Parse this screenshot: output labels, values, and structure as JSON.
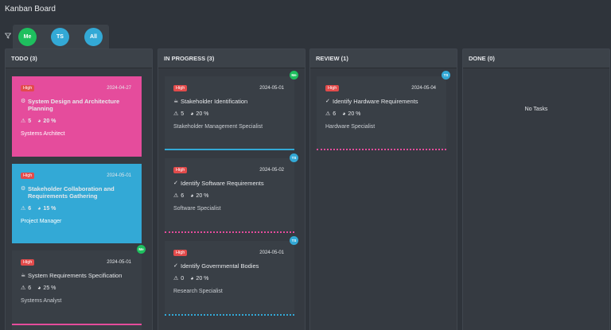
{
  "board": {
    "title": "Kanban Board"
  },
  "filters": [
    {
      "label": "Me",
      "color": "#1ebf5e"
    },
    {
      "label": "TS",
      "color": "#33a9d6"
    },
    {
      "label": "All",
      "color": "#33a9d6"
    }
  ],
  "columns": [
    {
      "title": "TODO (3)"
    },
    {
      "title": "IN PROGRESS (3)"
    },
    {
      "title": "REVIEW (1)"
    },
    {
      "title": "DONE (0)",
      "empty_text": "No Tasks"
    }
  ],
  "cards": [
    {
      "priority": "High",
      "date": "2024-04-27",
      "icon": "⚙",
      "title": "System Design and Architecture Planning",
      "warnings": "5",
      "progress": "20 %",
      "role": "Systems Architect"
    },
    {
      "priority": "High",
      "date": "2024-05-01",
      "icon": "⚙",
      "title": "Stakeholder Collaboration and Requirements Gathering",
      "warnings": "6",
      "progress": "15 %",
      "role": "Project Manager"
    },
    {
      "priority": "High",
      "date": "2024-05-01",
      "icon": "☕",
      "title": "System Requirements Specification",
      "warnings": "6",
      "progress": "25 %",
      "role": "Systems Analyst",
      "assignee": "Me"
    },
    {
      "priority": "High",
      "date": "2024-05-01",
      "icon": "☕",
      "title": "Stakeholder Identification",
      "warnings": "5",
      "progress": "20 %",
      "role": "Stakeholder Management Specialist",
      "assignee": "Me"
    },
    {
      "priority": "High",
      "date": "2024-05-02",
      "icon": "✓",
      "title": "Identify Software Requirements",
      "warnings": "6",
      "progress": "20 %",
      "role": "Software Specialist",
      "assignee": "TS"
    },
    {
      "priority": "High",
      "date": "2024-05-01",
      "icon": "✓",
      "title": "Identify Governmental Bodies",
      "warnings": "0",
      "progress": "20 %",
      "role": "Research Specialist",
      "assignee": "TS"
    },
    {
      "priority": "High",
      "date": "2024-05-04",
      "icon": "✓",
      "title": "Identify Hardware Requirements",
      "warnings": "6",
      "progress": "20 %",
      "role": "Hardware Specialist",
      "assignee": "TS"
    }
  ],
  "colors": {
    "me": "#1ebf5e",
    "ts": "#33a9d6",
    "pink": "#e54c9c",
    "blue": "#33a9d6",
    "high": "#e24b4b"
  }
}
